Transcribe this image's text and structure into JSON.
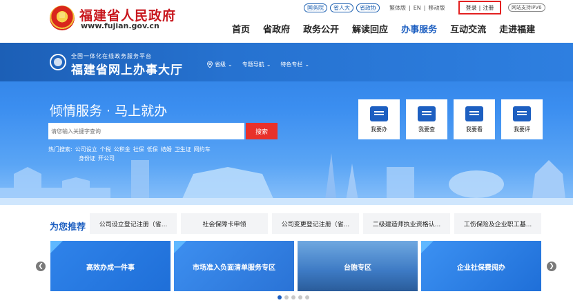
{
  "header": {
    "title": "福建省人民政府",
    "url": "www.fujian.gov.cn",
    "top_links": [
      "国务院",
      "省人大",
      "省政协"
    ],
    "lang_links": [
      "繁体版",
      "EN",
      "移动版"
    ],
    "login": "登录",
    "register": "注册",
    "ipv6": "网站支持IPV6",
    "nav": [
      "首页",
      "省政府",
      "政务公开",
      "解读回应",
      "办事服务",
      "互动交流",
      "走进福建"
    ]
  },
  "platform": {
    "subtitle": "全国一体化在线政务服务平台",
    "title": "福建省网上办事大厅",
    "nav": [
      "省级",
      "专题导航",
      "特色专栏"
    ]
  },
  "hero": {
    "slogan": "倾情服务 · 马上就办",
    "search_placeholder": "请您输入关键字查询",
    "search_button": "搜索",
    "hot_label": "热门搜索:",
    "hot_terms": [
      "公司设立",
      "个税",
      "公积金",
      "社保",
      "低保",
      "结婚",
      "卫生证",
      "网约车",
      "身份证",
      "开公司"
    ]
  },
  "quick_actions": [
    {
      "label": "我要办",
      "icon": "doc-icon"
    },
    {
      "label": "我要查",
      "icon": "monitor-search-icon"
    },
    {
      "label": "我要看",
      "icon": "view-icon"
    },
    {
      "label": "我要评",
      "icon": "chat-icon"
    }
  ],
  "recommend": {
    "label": "为您推荐",
    "items": [
      "公司设立登记注册（省...",
      "社会保障卡申领",
      "公司变更登记注册（省...",
      "二级建造师执业资格认...",
      "工伤保险及企业职工基..."
    ]
  },
  "cards": [
    {
      "label": "高效办成一件事"
    },
    {
      "label": "市场准入负面清单服务专区"
    },
    {
      "label": "台胞专区"
    },
    {
      "label": "企业社保费阅办"
    }
  ],
  "colors": {
    "brand_red": "#c8161d",
    "brand_blue": "#1d5fc1",
    "search_red": "#e8312a",
    "login_border": "#e32020"
  }
}
